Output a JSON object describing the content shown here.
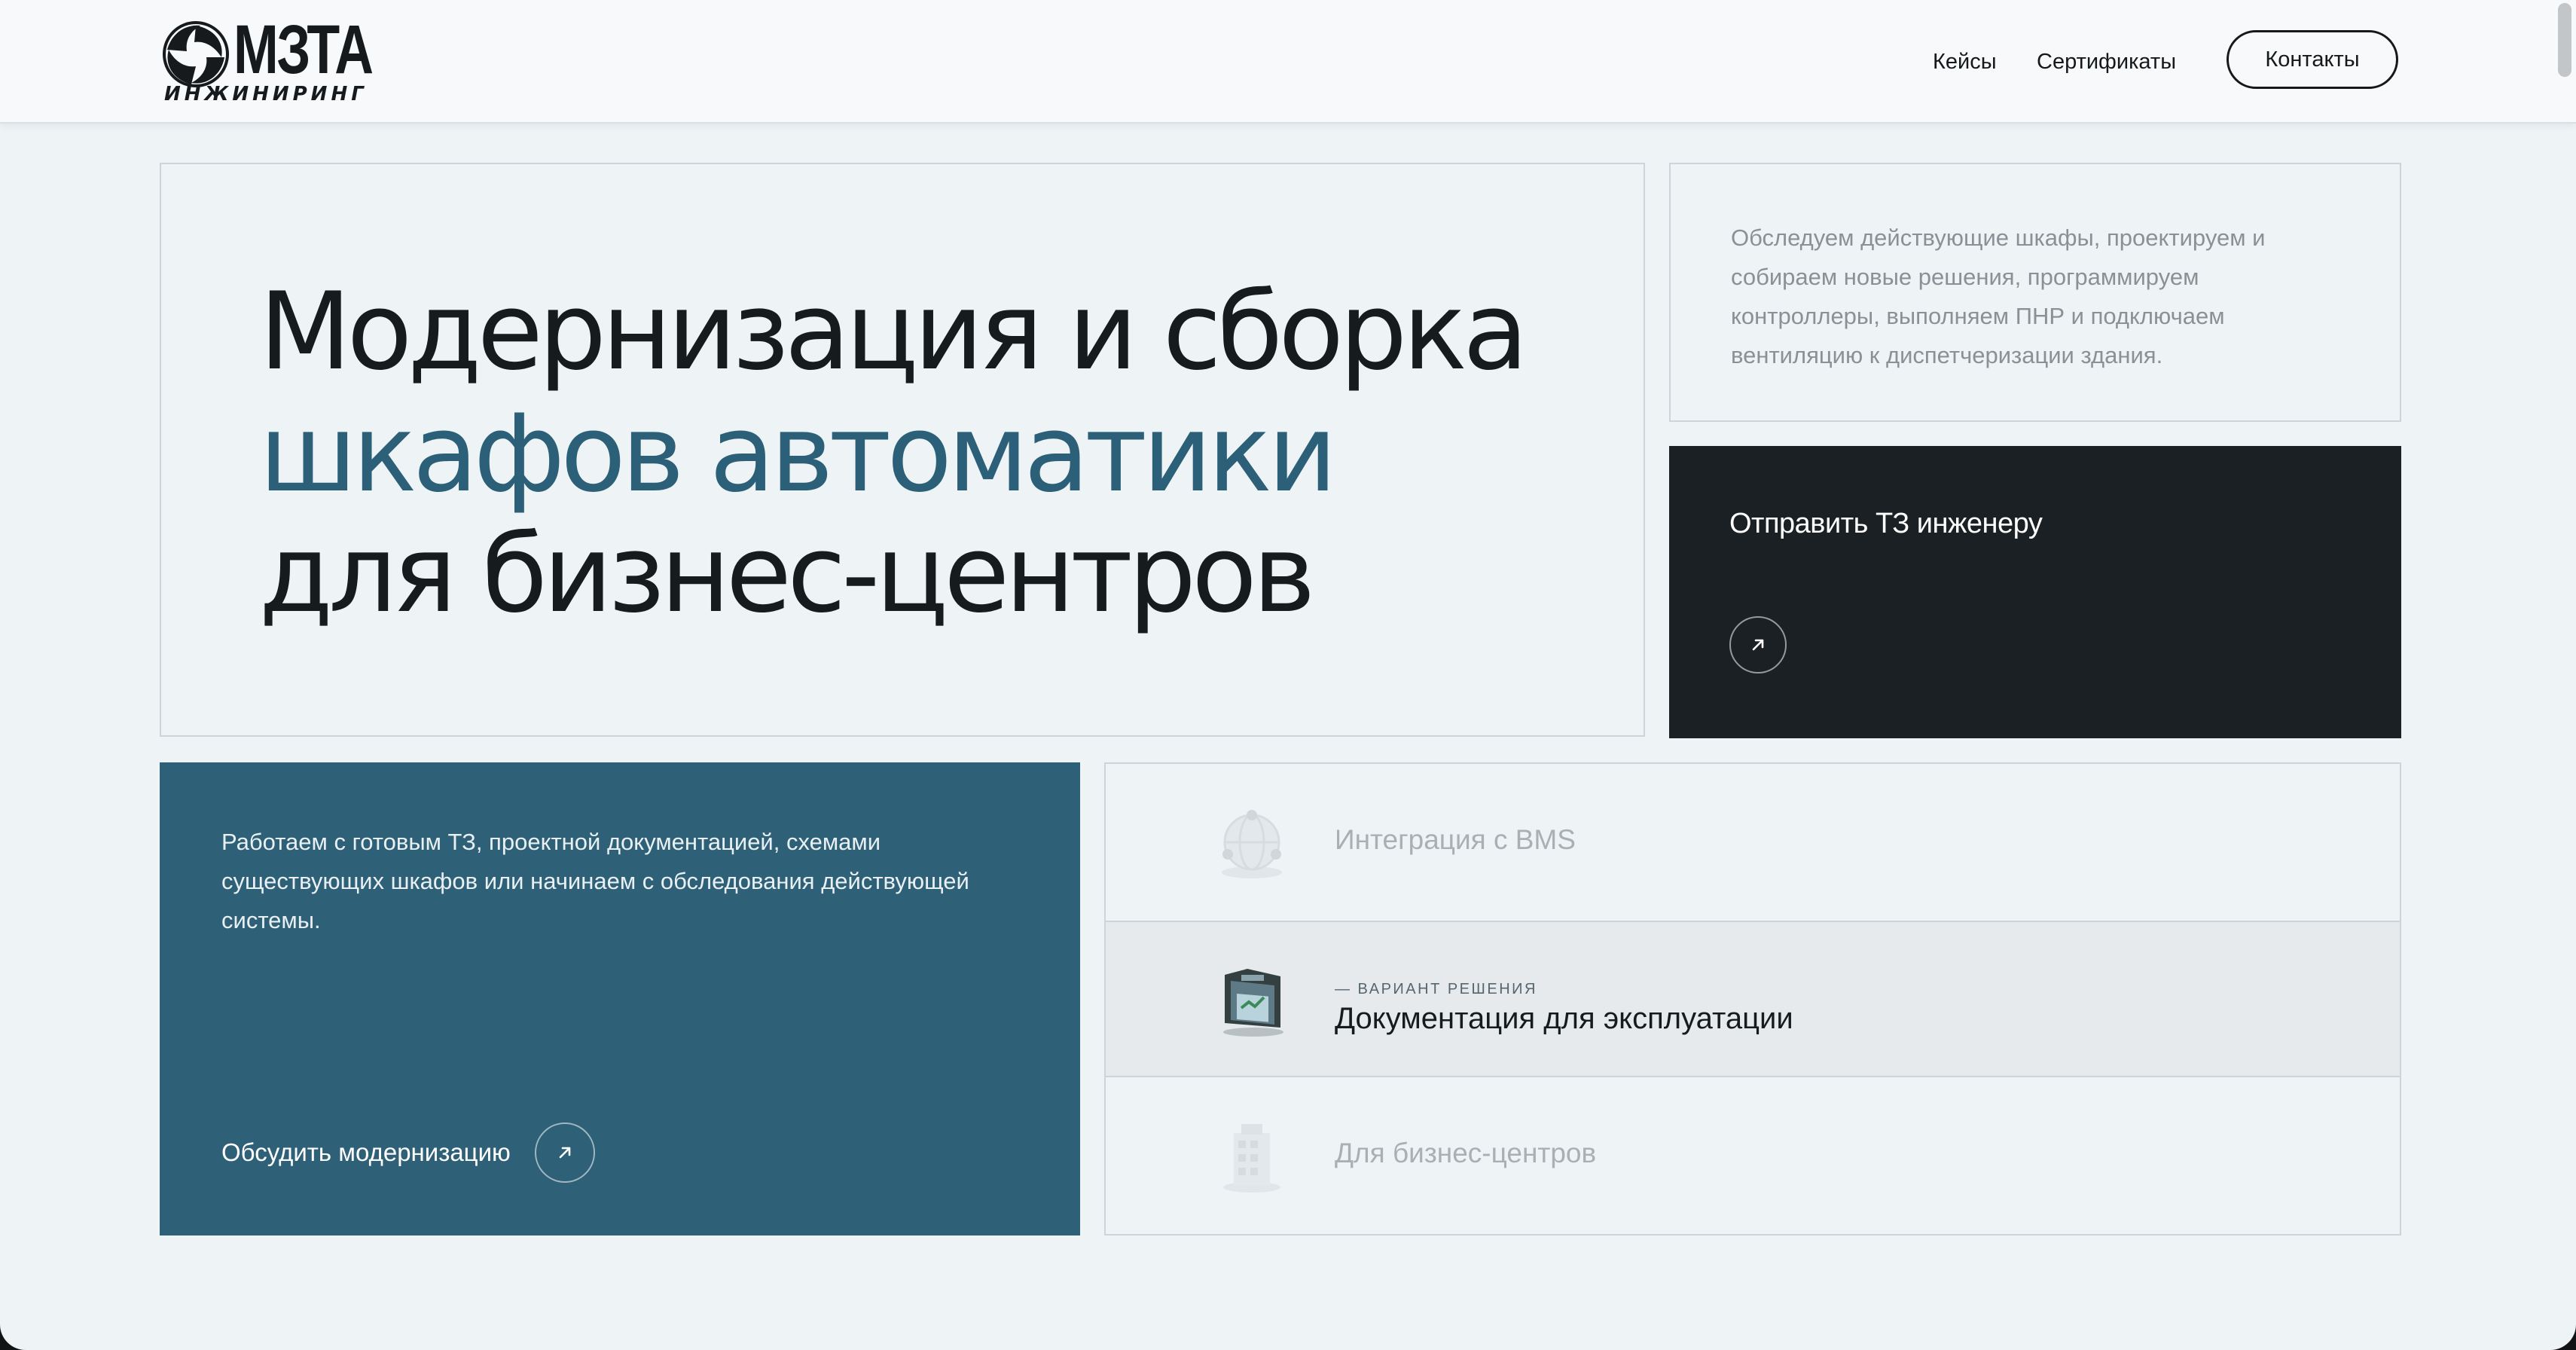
{
  "header": {
    "logo": {
      "wordmark": "МЗТА",
      "subtitle": "ИНЖИНИРИНГ"
    },
    "nav": [
      {
        "label": "Кейсы"
      },
      {
        "label": "Сертификаты"
      }
    ],
    "contacts_button": "Контакты"
  },
  "hero": {
    "line1": "Модернизация и сборка",
    "line2": "шкафов автоматики",
    "line3": "для бизнес-центров"
  },
  "info": {
    "text": "Обследуем действующие шкафы, проектируем и собираем новые решения, программируем контроллеры, выполняем ПНР и подключаем вентиляцию к диспетчеризации здания."
  },
  "cta_dark": {
    "title": "Отправить ТЗ инженеру",
    "icon": "arrow-up-right-icon"
  },
  "blue_card": {
    "text": "Работаем с готовым ТЗ, проектной документацией, схемами существующих шкафов или начинаем с обследования действующей системы.",
    "cta_label": "Обсудить модернизацию",
    "icon": "arrow-up-right-icon"
  },
  "solutions": {
    "items": [
      {
        "label": "Интеграция с BMS",
        "icon": "network-globe-icon",
        "active": false
      },
      {
        "kicker": "— ВАРИАНТ РЕШЕНИЯ",
        "label": "Документация для эксплуатации",
        "icon": "document-folder-icon",
        "active": true
      },
      {
        "label": "Для бизнес-центров",
        "icon": "building-icon",
        "active": false
      }
    ]
  },
  "colors": {
    "page_bg": "#eef3f6",
    "accent_blue": "#2e6077",
    "hero_accent_text": "#2c6078",
    "dark_card": "#1a2023",
    "border": "#cdd5da"
  }
}
